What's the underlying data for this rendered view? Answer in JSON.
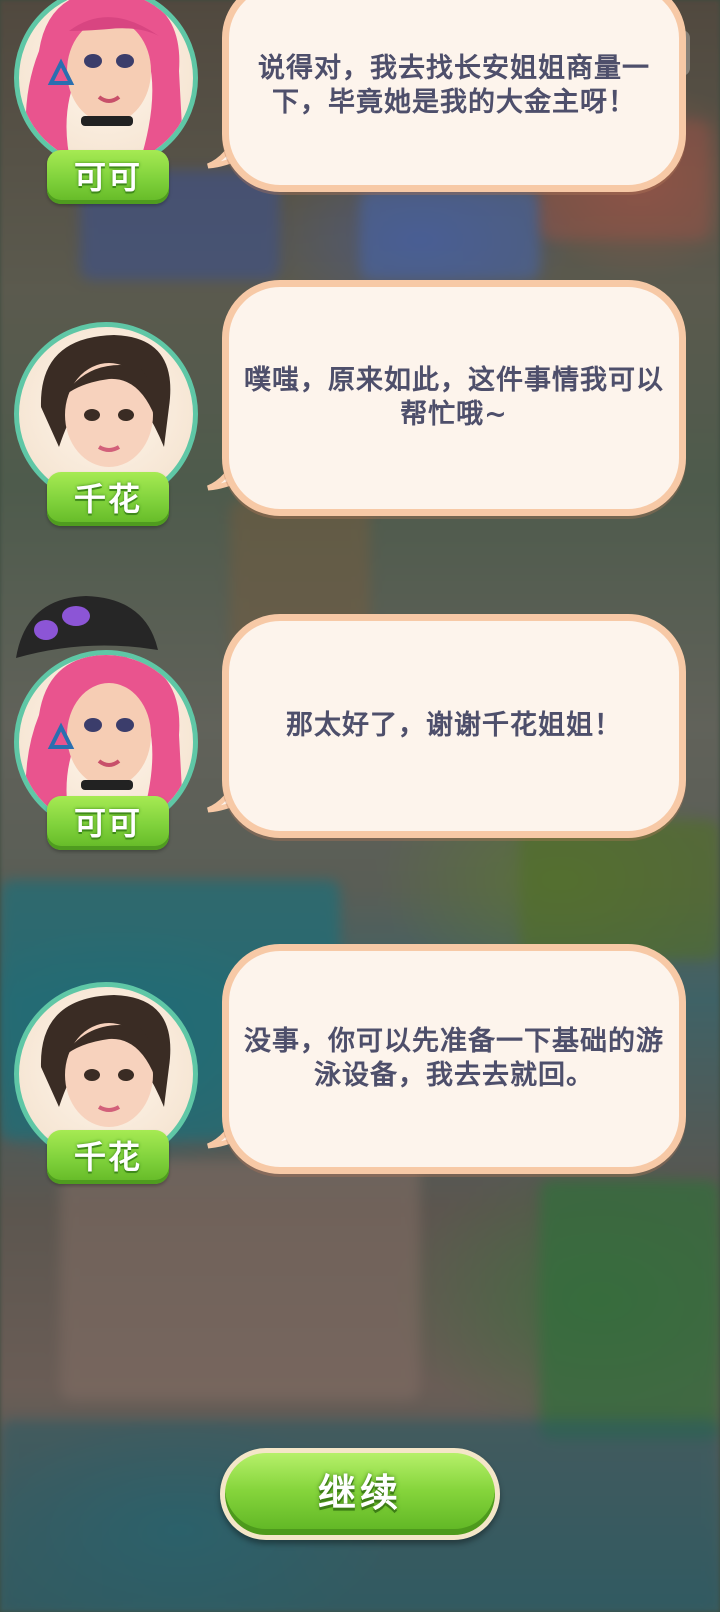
{
  "dialogue": [
    {
      "speaker": "可可",
      "text": "说得对，我去找长安姐姐商量一下，毕竟她是我的大金主呀！"
    },
    {
      "speaker": "千花",
      "text": "噗嗤，原来如此，这件事情我可以帮忙哦~"
    },
    {
      "speaker": "可可",
      "text": "那太好了，谢谢千花姐姐！"
    },
    {
      "speaker": "千花",
      "text": "没事，你可以先准备一下基础的游泳设备，我去去就回。"
    }
  ],
  "continue_label": "继续",
  "menu_chip_label": "--",
  "colors": {
    "bubble_fill": "#fdf4ec",
    "bubble_border": "#f7c9a6",
    "text": "#4e4f6b",
    "nametag_green": "#7fd13b",
    "avatar_ring": "#5fc7a6"
  }
}
